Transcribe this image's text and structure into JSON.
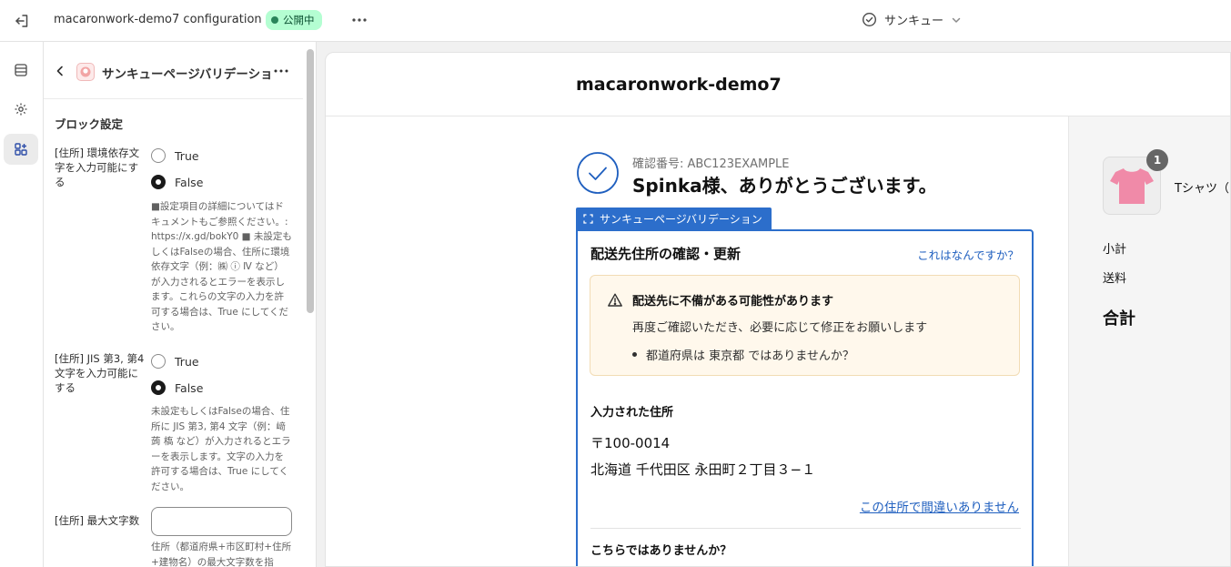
{
  "topbar": {
    "title": "macaronwork-demo7 configuration",
    "status": "公開中",
    "page_select": "サンキュー",
    "colors": {
      "status_bg": "#b4fed2",
      "status_text": "#0c5132"
    }
  },
  "rail": {
    "items": [
      {
        "icon": "sections-icon"
      },
      {
        "icon": "gear-icon"
      },
      {
        "icon": "apps-icon",
        "active": true
      }
    ]
  },
  "panel": {
    "title": "サンキューページバリデーション",
    "section_title": "ブロック設定",
    "fields": [
      {
        "label": "[住所] 環境依存文字を入力可能にする",
        "options": [
          "True",
          "False"
        ],
        "selected": "False",
        "help": "■設定項目の詳細についてはドキュメントもご参照ください。: https://x.gd/bokY0 ■ 未設定もしくはFalseの場合、住所に環境依存文字（例：㈱ ⓘ Ⅳ など）が入力されるとエラーを表示します。これらの文字の入力を許可する場合は、True にしてください。"
      },
      {
        "label": "[住所] JIS 第3, 第4 文字を入力可能にする",
        "options": [
          "True",
          "False"
        ],
        "selected": "False",
        "help": "未設定もしくはFalseの場合、住所に JIS 第3, 第4 文字（例：﨑 蒟 槗 など）が入力されるとエラーを表示します。文字の入力を許可する場合は、True にしてください。"
      },
      {
        "label": "[住所] 最大文字数",
        "value": "",
        "help": "住所（都道府県+市区町村+住所+建物名）の最大文字数を指"
      }
    ]
  },
  "preview": {
    "shop_name": "macaronwork-demo7",
    "confirmation_number": "確認番号: ABC123EXAMPLE",
    "thanks": "Spinka様、ありがとうございます。",
    "extension_tag": "サンキューページバリデーション",
    "card": {
      "title": "配送先住所の確認・更新",
      "help_link": "これはなんですか？",
      "warning_title": "配送先に不備がある可能性があります",
      "warning_body": "再度ご確認いただき、必要に応じて修正をお願いします",
      "warning_bullet": "都道府県は 東京都 ではありませんか？",
      "entered_title": "入力された住所",
      "zip": "〒100-0014",
      "address": "北海道  千代田区  永田町２丁目３−１",
      "confirm_link": "この住所で間違いありません",
      "alternatives_title": "こちらではありませんか？"
    },
    "summary": {
      "product_name": "Tシャツ（",
      "quantity": "1",
      "subtotal_label": "小計",
      "shipping_label": "送料",
      "total_label": "合計"
    },
    "colors": {
      "accent": "#2c6ecb",
      "warning_bg": "#fff8ec",
      "link": "#1f5fbf",
      "product": "#f08aa8"
    }
  }
}
